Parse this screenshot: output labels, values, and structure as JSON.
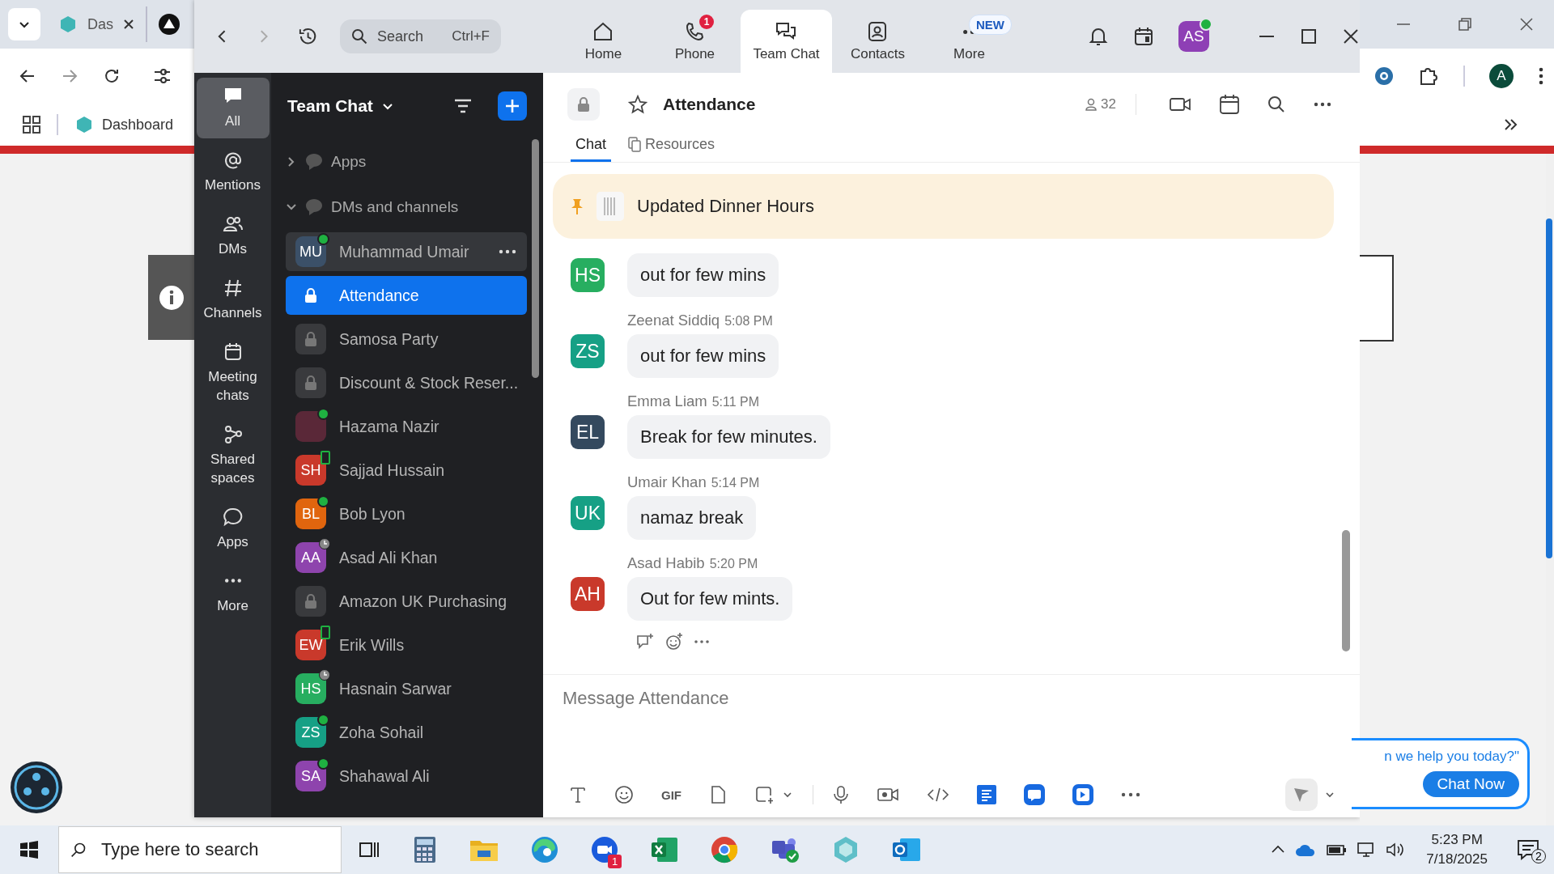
{
  "browser": {
    "tab_title": "Das",
    "bookmark": "Dashboard",
    "profile_initial": "A"
  },
  "window": {
    "search": {
      "placeholder": "Search",
      "shortcut": "Ctrl+F"
    },
    "nav": [
      {
        "kind": "home",
        "label": "Home",
        "selected": false
      },
      {
        "kind": "phone",
        "label": "Phone",
        "badge": "1",
        "selected": false
      },
      {
        "kind": "chat",
        "label": "Team Chat",
        "selected": true
      },
      {
        "kind": "contacts",
        "label": "Contacts",
        "selected": false
      },
      {
        "kind": "more",
        "label": "More",
        "badge": "NEW",
        "selected": false
      }
    ],
    "user_initials": "AS"
  },
  "rail": [
    {
      "kind": "all",
      "label": "All",
      "selected": true
    },
    {
      "kind": "mentions",
      "label": "Mentions",
      "selected": false
    },
    {
      "kind": "dms",
      "label": "DMs",
      "selected": false
    },
    {
      "kind": "channels",
      "label": "Channels",
      "selected": false
    },
    {
      "kind": "meetings",
      "label": "Meeting chats",
      "selected": false
    },
    {
      "kind": "spaces",
      "label": "Shared spaces",
      "selected": false
    },
    {
      "kind": "apps",
      "label": "Apps",
      "selected": false
    },
    {
      "kind": "more",
      "label": "More",
      "selected": false
    }
  ],
  "list": {
    "title": "Team Chat",
    "sections": [
      {
        "label": "Apps",
        "expanded": false
      },
      {
        "label": "DMs and channels",
        "expanded": true,
        "children": [
          {
            "kind": "dm",
            "name": "Muhammad Umair",
            "initials": "MU",
            "color": "#3b5068",
            "presence": {
              "kind": "online"
            },
            "selected": false,
            "hovered": true
          },
          {
            "kind": "channel",
            "name": "Attendance",
            "selected": true,
            "hovered": false
          },
          {
            "kind": "channel",
            "name": "Samosa Party",
            "selected": false,
            "hovered": false
          },
          {
            "kind": "channel",
            "name": "Discount & Stock Reser...",
            "selected": false,
            "hovered": false
          },
          {
            "kind": "dm",
            "name": "Hazama Nazir",
            "color": "#5a2838",
            "presence": {
              "kind": "online"
            },
            "selected": false,
            "hovered": false
          },
          {
            "kind": "dm",
            "name": "Sajjad Hussain",
            "initials": "SH",
            "color": "#c9392b",
            "presence": {
              "kind": "mobile"
            },
            "selected": false,
            "hovered": false
          },
          {
            "kind": "dm",
            "name": "Bob Lyon",
            "initials": "BL",
            "color": "#e0650e",
            "presence": {
              "kind": "online"
            },
            "selected": false,
            "hovered": false
          },
          {
            "kind": "dm",
            "name": "Asad Ali Khan",
            "initials": "AA",
            "color": "#8e44ad",
            "presence": {
              "kind": "away"
            },
            "selected": false,
            "hovered": false
          },
          {
            "kind": "channel",
            "name": "Amazon UK Purchasing",
            "selected": false,
            "hovered": false
          },
          {
            "kind": "dm",
            "name": "Erik Wills",
            "initials": "EW",
            "color": "#c9392b",
            "presence": {
              "kind": "mobile"
            },
            "selected": false,
            "hovered": false
          },
          {
            "kind": "dm",
            "name": "Hasnain Sarwar",
            "initials": "HS",
            "color": "#27ae60",
            "presence": {
              "kind": "away"
            },
            "selected": false,
            "hovered": false
          },
          {
            "kind": "dm",
            "name": "Zoha Sohail",
            "initials": "ZS",
            "color": "#16a085",
            "presence": {
              "kind": "online"
            },
            "selected": false,
            "hovered": false
          },
          {
            "kind": "dm",
            "name": "Shahawal Ali",
            "initials": "SA",
            "color": "#8e44ad",
            "presence": {
              "kind": "online"
            },
            "selected": false,
            "hovered": false
          }
        ]
      }
    ]
  },
  "chat": {
    "title": "Attendance",
    "members": "32",
    "tabs": [
      {
        "label": "Chat",
        "selected": true
      },
      {
        "label": "Resources",
        "selected": false
      }
    ],
    "pinned": "Updated Dinner Hours",
    "messages": [
      {
        "initials": "HS",
        "color": "#27ae60",
        "text": "out for few mins"
      },
      {
        "sender": "Zeenat Siddiq",
        "time": "5:08 PM",
        "initials": "ZS",
        "color": "#16a085",
        "text": "out for few mins"
      },
      {
        "sender": "Emma Liam",
        "time": "5:11 PM",
        "initials": "EL",
        "color": "#34495e",
        "text": "Break for few minutes."
      },
      {
        "sender": "Umair Khan",
        "time": "5:14 PM",
        "initials": "UK",
        "color": "#16a085",
        "text": "namaz break"
      },
      {
        "sender": "Asad Habib",
        "time": "5:20 PM",
        "initials": "AH",
        "color": "#c9392b",
        "text": "Out for few mints."
      }
    ],
    "composer": {
      "placeholder": "Message Attendance",
      "gif": "GIF"
    }
  },
  "widget": {
    "text": "n we help you today?\"",
    "button": "Chat Now"
  },
  "taskbar": {
    "search_placeholder": "Type here to search",
    "zoom_badge": "1",
    "time": "5:23 PM",
    "date": "7/18/2025",
    "notifications": "2"
  }
}
